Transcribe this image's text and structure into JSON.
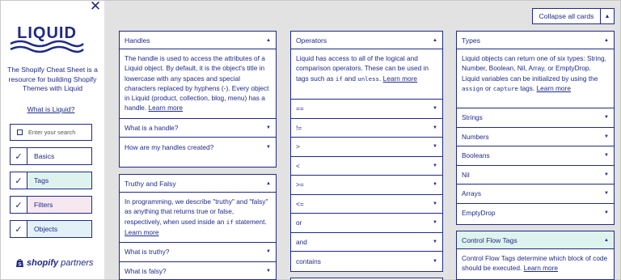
{
  "sidebar": {
    "logo_text": "LIQUID",
    "tagline": "The Shopify Cheat Sheet is a resource for building Shopify Themes with Liquid",
    "what_link": "What is Liquid?",
    "search_placeholder": "Enter your search",
    "categories": [
      {
        "label": "Basics",
        "checked": true,
        "color": "#ffffff"
      },
      {
        "label": "Tags",
        "checked": true,
        "color": "#dff3ee"
      },
      {
        "label": "Filters",
        "checked": true,
        "color": "#f7e8ef"
      },
      {
        "label": "Objects",
        "checked": true,
        "color": "#e2f0f8"
      }
    ],
    "brand_word": "shopify",
    "brand_suffix": "partners",
    "check_glyph": "✓"
  },
  "header": {
    "collapse_all_label": "Collapse all cards",
    "close_icon": "✕"
  },
  "cards": {
    "handles": {
      "title": "Handles",
      "desc": "The handle is used to access the attributes of a Liquid object. By default, it is the object's title in lowercase with any spaces and special characters replaced by hyphens (-). Every object in Liquid (product, collection, blog, menu) has a handle.",
      "link": "Learn more",
      "rows": [
        "What is a handle?",
        "How are my handles created?"
      ]
    },
    "truthy": {
      "title": "Truthy and Falsy",
      "desc_before": "In programming, we describe \"truthy\" and \"falsy\" as anything that returns true or false, respectively, when used inside an",
      "desc_code": "if",
      "desc_after": "statement.",
      "link": "Learn more",
      "rows": [
        "What is truthy?",
        "What is falsy?"
      ]
    },
    "operators": {
      "title": "Operators",
      "desc_before": "Liquid has access to all of the logical and comparison operators. These can be used in tags such as",
      "code1": "if",
      "desc_mid": "and",
      "code2": "unless",
      "link": "Learn more",
      "rows": [
        "==",
        "!=",
        ">",
        "<",
        ">=",
        "<=",
        "or",
        "and",
        "contains"
      ]
    },
    "types": {
      "title": "Types",
      "desc_before": "Liquid objects can return one of six types: String, Number, Boolean, Nil, Array, or EmptyDrop. Liquid variables can be initialized by using the",
      "code1": "assign",
      "desc_mid": "or",
      "code2": "capture",
      "desc_after": "tags.",
      "link": "Learn more",
      "rows": [
        "Strings",
        "Numbers",
        "Booleans",
        "Nil",
        "Arrays",
        "EmptyDrop"
      ]
    },
    "control_flow": {
      "title": "Control Flow Tags",
      "desc": "Control Flow Tags determine which block of code should be executed.",
      "link": "Learn more",
      "accent": "#dff3ee"
    }
  },
  "icons": {
    "expand": "▼",
    "collapse": "▲"
  }
}
